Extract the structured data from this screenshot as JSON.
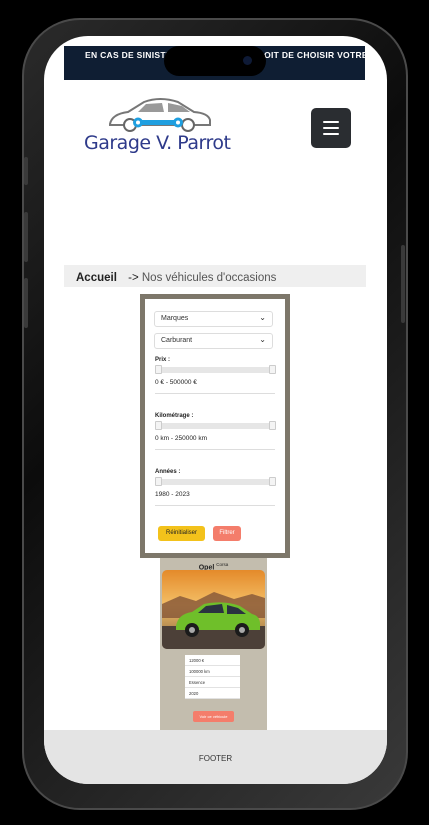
{
  "banner": {
    "text": "EN CAS DE SINISTRE, VOUS AVEZ LE DROIT DE CHOISIR VOTRE"
  },
  "brand": {
    "name": "Garage V. Parrot",
    "logo_color": "#2e3a8a",
    "accent_color": "#1f9fe0"
  },
  "breadcrumb": {
    "home": "Accueil",
    "separator": "->",
    "current": "Nos véhicules d'occasions"
  },
  "filters": {
    "brand_select": "Marques",
    "fuel_select": "Carburant",
    "price": {
      "label": "Prix :",
      "value": "0 € - 500000 €"
    },
    "mileage": {
      "label": "Kilométrage :",
      "value": "0 km - 250000 km"
    },
    "years": {
      "label": "Années :",
      "value": "1980 - 2023"
    },
    "reset_label": "Réinitialiser",
    "filter_label": "Filtrer"
  },
  "vehicle": {
    "make": "Opel",
    "model": "Corsa",
    "price": "12000 €",
    "mileage": "100000 km",
    "fuel": "Essence",
    "year": "2020",
    "cta": "Voir ce véhicule"
  },
  "footer": {
    "text": "FOOTER"
  },
  "colors": {
    "banner_bg": "#0f1e33",
    "filter_border": "#7d776a",
    "card_bg": "#c3bdae",
    "reset_bg": "#f3c21b",
    "filter_bg": "#f47d6b"
  }
}
